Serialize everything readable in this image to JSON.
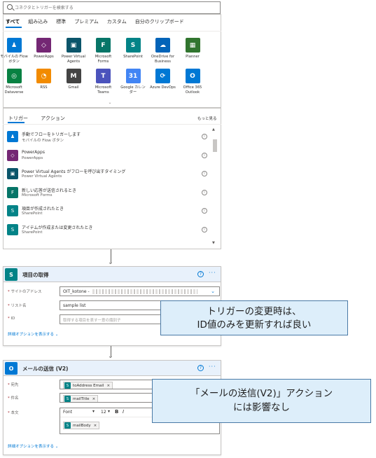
{
  "search": {
    "placeholder": "コネクタとトリガーを検索する"
  },
  "tabs": [
    "すべて",
    "組み込み",
    "標準",
    "プレミアム",
    "カスタム",
    "自分のクリップボード"
  ],
  "connectors": [
    {
      "label": "モバイルの Flow ボタン",
      "color": "#0078d4",
      "icon": "person-icon",
      "glyph": "♟"
    },
    {
      "label": "PowerApps",
      "color": "#742774",
      "icon": "powerapps-icon",
      "glyph": "◇"
    },
    {
      "label": "Power Virtual Agents",
      "color": "#0b556a",
      "icon": "chat-icon",
      "glyph": "▣"
    },
    {
      "label": "Microsoft Forms",
      "color": "#077568",
      "icon": "forms-icon",
      "glyph": "F"
    },
    {
      "label": "SharePoint",
      "color": "#038387",
      "icon": "sharepoint-icon",
      "glyph": "S"
    },
    {
      "label": "OneDrive for Business",
      "color": "#0364b8",
      "icon": "cloud-icon",
      "glyph": "☁"
    },
    {
      "label": "Planner",
      "color": "#31752f",
      "icon": "planner-icon",
      "glyph": "▦"
    },
    {
      "label": "Microsoft Dataverse",
      "color": "#088142",
      "icon": "dataverse-icon",
      "glyph": "◎"
    },
    {
      "label": "RSS",
      "color": "#f28b00",
      "icon": "rss-icon",
      "glyph": "◔"
    },
    {
      "label": "Gmail",
      "color": "#444444",
      "icon": "mail-icon",
      "glyph": "M"
    },
    {
      "label": "Microsoft Teams",
      "color": "#4b53bc",
      "icon": "teams-icon",
      "glyph": "T"
    },
    {
      "label": "Google カレンダー",
      "color": "#4285f4",
      "icon": "calendar-icon",
      "glyph": "31"
    },
    {
      "label": "Azure DevOps",
      "color": "#0078d4",
      "icon": "devops-icon",
      "glyph": "⟳"
    },
    {
      "label": "Office 365 Outlook",
      "color": "#0078d4",
      "icon": "outlook-icon",
      "glyph": "O"
    }
  ],
  "subtabs": [
    "トリガー",
    "アクション"
  ],
  "more_label": "もっと見る",
  "triggers": [
    {
      "title": "手動でフローをトリガーします",
      "subtitle": "モバイルの Flow ボタン",
      "color": "#0078d4",
      "glyph": "♟",
      "icon": "person-icon"
    },
    {
      "title": "PowerApps",
      "subtitle": "PowerApps",
      "color": "#742774",
      "glyph": "◇",
      "icon": "powerapps-icon"
    },
    {
      "title": "Power Virtual Agents がフローを呼び出すタイミング",
      "subtitle": "Power Virtual Agents",
      "color": "#0b556a",
      "glyph": "▣",
      "icon": "chat-icon"
    },
    {
      "title": "新しい応答が送信されるとき",
      "subtitle": "Microsoft Forms",
      "color": "#077568",
      "glyph": "F",
      "icon": "forms-icon"
    },
    {
      "title": "項目が作成されたとき",
      "subtitle": "SharePoint",
      "color": "#038387",
      "glyph": "S",
      "icon": "sharepoint-icon"
    },
    {
      "title": "アイテムが作成または変更されたとき",
      "subtitle": "SharePoint",
      "color": "#038387",
      "glyph": "S",
      "icon": "sharepoint-icon"
    }
  ],
  "card1": {
    "title": "項目の取得",
    "site_label": "サイトのアドレス",
    "site_value": "OIT_kotone -",
    "list_label": "リスト名",
    "list_value": "sample list",
    "id_label": "ID",
    "id_placeholder": "取得する項目を表す一意の識別子",
    "advanced": "詳細オプションを表示する",
    "help": "?",
    "dots": "···"
  },
  "card2": {
    "title": "メールの送信 (V2)",
    "to_label": "宛先",
    "to_token": "toAddress Email",
    "subject_label": "件名",
    "subject_token": "mailTitle",
    "body_label": "本文",
    "font_label": "Font",
    "font_size": "12",
    "bold": "B",
    "italic": "I",
    "body_token": "mailBody",
    "advanced": "詳細オプションを表示する",
    "help": "?",
    "dots": "···"
  },
  "callout1": {
    "line1": "トリガーの変更時は、",
    "line2": "ID値のみを更新すれば良い"
  },
  "callout2": {
    "line1": "「メールの送信(V2)」アクション",
    "line2": "には影響なし"
  },
  "colors": {
    "accent": "#0078d4",
    "card_header": "#e8f1fb",
    "callout_bg": "#ddeefa",
    "callout_border": "#4a7aa6"
  }
}
